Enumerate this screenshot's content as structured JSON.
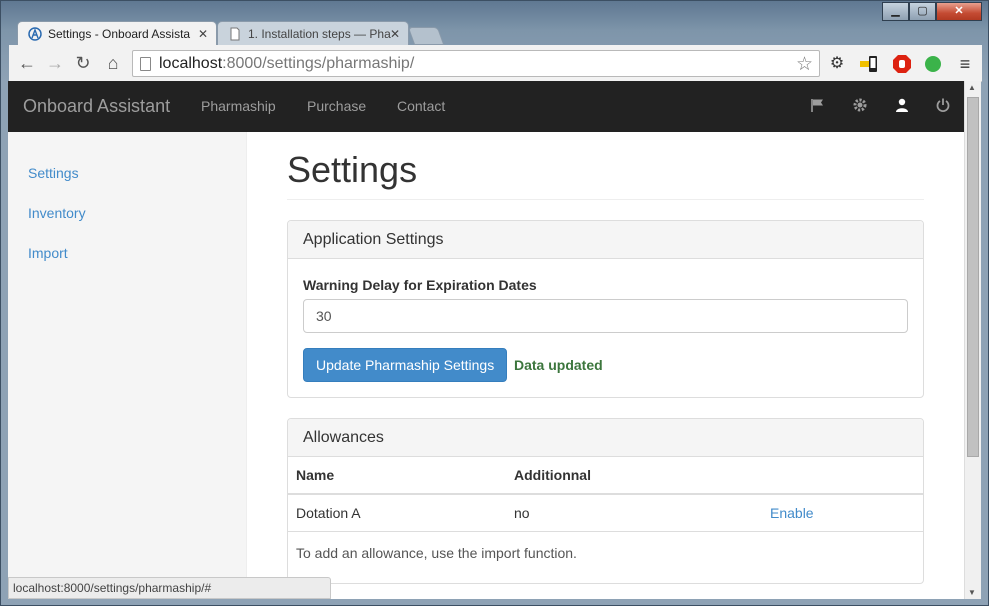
{
  "browser": {
    "tabs": [
      {
        "title": "Settings - Onboard Assista",
        "active": true
      },
      {
        "title": "1. Installation steps — Pha",
        "active": false
      }
    ],
    "window_controls": {
      "minimize": "▁",
      "maximize": "▢",
      "close": "✕"
    },
    "url_host": "localhost",
    "url_rest": ":8000/settings/pharmaship/",
    "status_url": "localhost:8000/settings/pharmaship/#"
  },
  "navbar": {
    "brand": "Onboard Assistant",
    "links": [
      "Pharmaship",
      "Purchase",
      "Contact"
    ],
    "icons": [
      "flag-icon",
      "gear-icon",
      "user-icon",
      "power-icon"
    ]
  },
  "sidebar": {
    "items": [
      "Settings",
      "Inventory",
      "Import"
    ]
  },
  "main": {
    "title": "Settings",
    "app_settings": {
      "heading": "Application Settings",
      "field_label": "Warning Delay for Expiration Dates",
      "field_value": "30",
      "button_label": "Update Pharmaship Settings",
      "status": "Data updated"
    },
    "allowances": {
      "heading": "Allowances",
      "columns": [
        "Name",
        "Additionnal",
        ""
      ],
      "rows": [
        {
          "name": "Dotation A",
          "additional": "no",
          "action": "Enable"
        }
      ],
      "footer": "To add an allowance, use the import function."
    }
  },
  "colors": {
    "navbar_bg": "#222222",
    "link": "#428bca",
    "primary_button": "#428bca",
    "success_text": "#3c763d"
  }
}
